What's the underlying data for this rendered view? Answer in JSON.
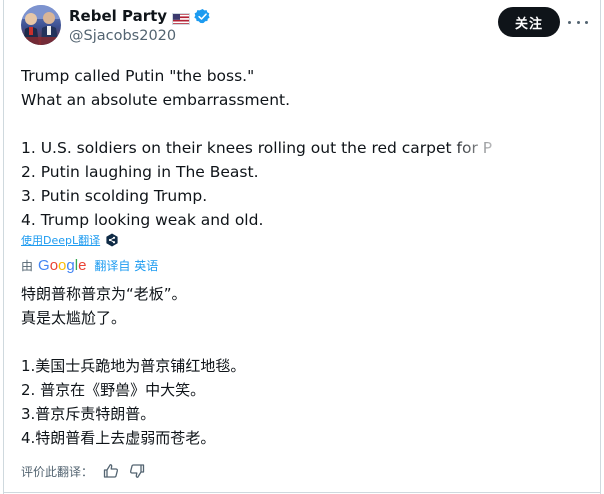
{
  "author": {
    "display_name": "Rebel Party",
    "handle": "@Sjacobs2020",
    "flag": "us-flag-icon",
    "verified": "verified-badge-icon",
    "verified_color": "#1d9bf0"
  },
  "actions": {
    "follow_label": "关注",
    "more": "more-icon"
  },
  "tweet": {
    "lines": [
      "Trump called Putin \"the boss.\"",
      "What an absolute embarrassment.",
      "",
      "1. U.S. soldiers on their knees rolling out the red carpet for P",
      "2. Putin laughing in The Beast.",
      "3. Putin scolding Trump.",
      "4. Trump looking weak and old."
    ]
  },
  "deepl": {
    "label": "使用DeepL翻译",
    "icon": "deepl-icon"
  },
  "google": {
    "prefix": "由",
    "logo_text": "Google",
    "translated_from": "翻译自 英语"
  },
  "translation": {
    "lines": [
      "特朗普称普京为“老板”。",
      "真是太尴尬了。",
      "",
      "1.美国士兵跪地为普京铺红地毯。",
      "2. 普京在《野兽》中大笑。",
      "3.普京斥责特朗普。",
      "4.特朗普看上去虚弱而苍老。"
    ]
  },
  "rating": {
    "label": "评价此翻译：",
    "up_icon": "thumbs-up-icon",
    "down_icon": "thumbs-down-icon"
  },
  "colors": {
    "text": "#0f1419",
    "secondary": "#536471",
    "accent": "#1d9bf0",
    "button": "#0f1419"
  }
}
